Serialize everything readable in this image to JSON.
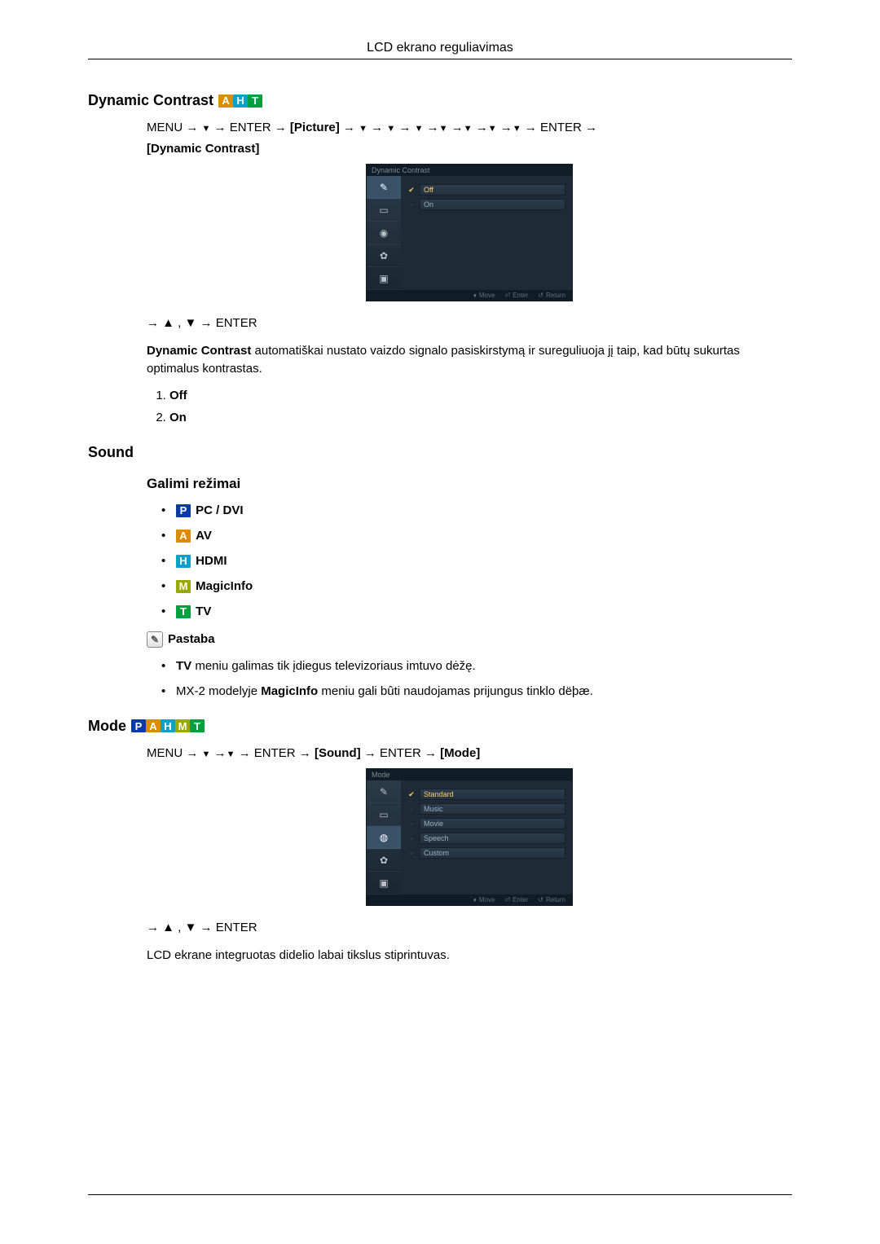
{
  "page_header": "LCD ekrano reguliavimas",
  "sections": {
    "dynamic_contrast": {
      "title": "Dynamic Contrast",
      "nav1_prefix": "MENU → ",
      "nav1_enter": " → ENTER → ",
      "nav1_picture": "[Picture]",
      "nav1_mid": " → ",
      "nav1_suffix": " → ENTER → ",
      "nav1_item": "[Dynamic Contrast]",
      "nav2": "→ ▲ , ▼ → ENTER",
      "desc_bold": "Dynamic Contrast",
      "desc_rest": " automatiškai nustato vaizdo signalo pasiskirstymą ir sureguliuoja jį taip, kad būtų sukurtas optimalus kontrastas.",
      "options": [
        "Off",
        "On"
      ],
      "osd": {
        "title": "Dynamic Contrast",
        "items": [
          "Off",
          "On"
        ],
        "footer": {
          "move": "Move",
          "enter": "Enter",
          "ret": "Return"
        }
      }
    },
    "sound": {
      "title": "Sound",
      "sub": "Galimi režimai",
      "modes": [
        {
          "k": "P",
          "label": "PC / DVI"
        },
        {
          "k": "A",
          "label": "AV"
        },
        {
          "k": "H",
          "label": "HDMI"
        },
        {
          "k": "M",
          "label": "MagicInfo"
        },
        {
          "k": "T",
          "label": "TV"
        }
      ],
      "note_title": "Pastaba",
      "notes": [
        {
          "bold": "TV",
          "rest": " meniu galimas tik įdiegus televizoriaus imtuvo dėžę."
        },
        {
          "pre": "MX-2 modelyje ",
          "bold": "MagicInfo",
          "rest": " meniu gali bûti naudojamas prijungus tinklo dëþæ."
        }
      ]
    },
    "mode": {
      "title": "Mode",
      "nav1_prefix": "MENU → ",
      "nav1_enter": " → ENTER → ",
      "nav1_sound": "[Sound]",
      "nav1_mid": " → ENTER → ",
      "nav1_item": "[Mode]",
      "nav2": "→ ▲ , ▼ → ENTER",
      "desc": "LCD ekrane integruotas didelio labai tikslus stiprintuvas.",
      "osd": {
        "title": "Mode",
        "items": [
          "Standard",
          "Music",
          "Movie",
          "Speech",
          "Custom"
        ],
        "footer": {
          "move": "Move",
          "enter": "Enter",
          "ret": "Return"
        }
      }
    }
  }
}
